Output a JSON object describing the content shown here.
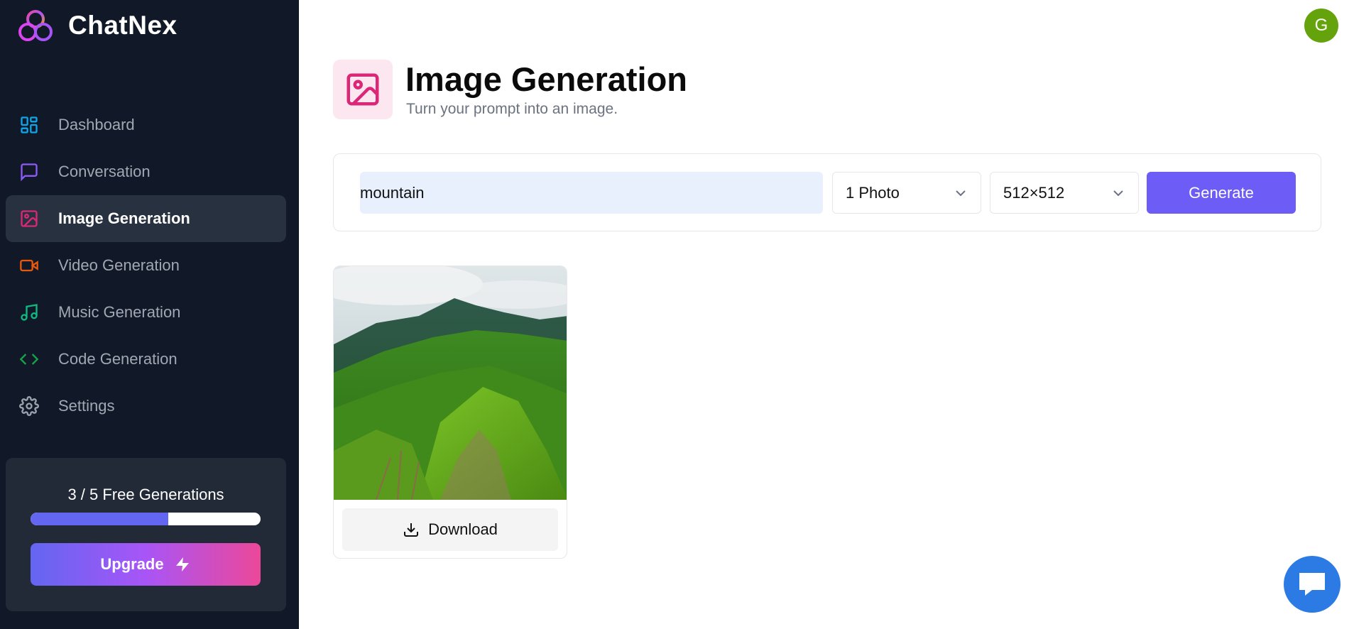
{
  "app": {
    "name": "ChatNex"
  },
  "sidebar": {
    "items": [
      {
        "label": "Dashboard",
        "icon": "dashboard-icon",
        "color": "#0ea5e9"
      },
      {
        "label": "Conversation",
        "icon": "message-square-icon",
        "color": "#8b5cf6"
      },
      {
        "label": "Image Generation",
        "icon": "image-icon",
        "color": "#db2777",
        "active": true
      },
      {
        "label": "Video Generation",
        "icon": "video-icon",
        "color": "#ea580c"
      },
      {
        "label": "Music Generation",
        "icon": "music-icon",
        "color": "#10b981"
      },
      {
        "label": "Code Generation",
        "icon": "code-icon",
        "color": "#16a34a"
      },
      {
        "label": "Settings",
        "icon": "settings-icon",
        "color": "#9ca3af"
      }
    ],
    "free_generations": {
      "text": "3 / 5 Free Generations",
      "used": 3,
      "total": 5,
      "progress_fraction": 0.6
    },
    "upgrade_label": "Upgrade"
  },
  "user": {
    "avatar_initial": "G",
    "avatar_color": "#65a30d"
  },
  "header": {
    "title": "Image Generation",
    "subtitle": "Turn your prompt into an image.",
    "icon": "image-icon",
    "accent": "#db2777"
  },
  "form": {
    "prompt_value": "mountain",
    "amount_value": "1 Photo",
    "resolution_value": "512×512",
    "generate_label": "Generate"
  },
  "results": [
    {
      "image": "mountain-photo",
      "download_label": "Download"
    }
  ],
  "chat_widget": {
    "icon": "chat-bubble-icon"
  },
  "colors": {
    "sidebar_bg": "#111827",
    "primary": "#6d5cf6"
  }
}
